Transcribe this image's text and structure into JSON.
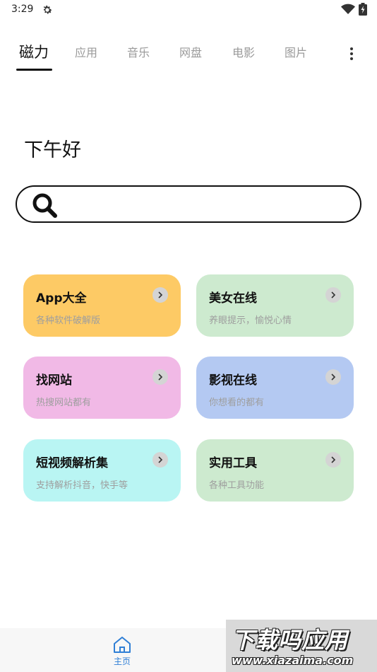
{
  "status_bar": {
    "time": "3:29",
    "icons": [
      "gear-icon",
      "wifi-icon",
      "battery-icon"
    ]
  },
  "tabs": [
    {
      "label": "磁力",
      "active": true
    },
    {
      "label": "应用",
      "active": false
    },
    {
      "label": "音乐",
      "active": false
    },
    {
      "label": "网盘",
      "active": false
    },
    {
      "label": "电影",
      "active": false
    },
    {
      "label": "图片",
      "active": false
    }
  ],
  "menu": {
    "icon": "more-vertical-icon"
  },
  "greeting": "下午好",
  "search": {
    "value": "",
    "placeholder": "",
    "icon": "search-icon"
  },
  "cards": [
    {
      "title": "App大全",
      "subtitle": "各种软件破解版",
      "color": "#fdca65"
    },
    {
      "title": "美女在线",
      "subtitle": "养眼提示，愉悦心情",
      "color": "#cdeacf"
    },
    {
      "title": "找网站",
      "subtitle": "热搜网站都有",
      "color": "#f1b9e6"
    },
    {
      "title": "影视在线",
      "subtitle": "你想看的都有",
      "color": "#b4c9f2"
    },
    {
      "title": "短视频解析集",
      "subtitle": "支持解析抖音，快手等",
      "color": "#b9f5f3"
    },
    {
      "title": "实用工具",
      "subtitle": "各种工具功能",
      "color": "#cdeacf"
    }
  ],
  "bottom_nav": {
    "home": {
      "label": "主页",
      "icon": "home-icon",
      "color": "#2f7fd6"
    }
  },
  "watermark": {
    "main": "下载吗应用",
    "url": "www.xiazaima.com"
  }
}
